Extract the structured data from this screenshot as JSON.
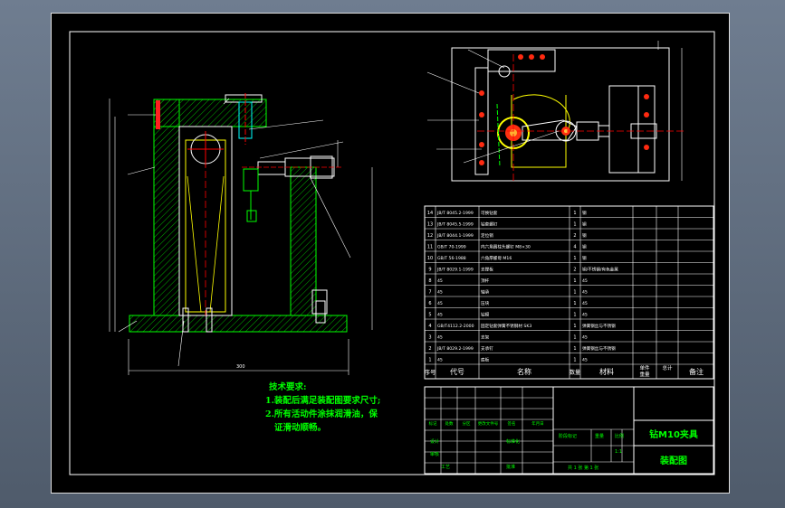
{
  "bom": {
    "header": {
      "no": "序号",
      "code": "代号",
      "name": "名称",
      "qty": "数量",
      "material": "材料",
      "unit_weight_a": "单件",
      "unit_weight_b": "重量",
      "total_weight_a": "总计",
      "total_weight_b": "",
      "remark": "备注"
    },
    "rows": [
      {
        "no": "14",
        "code": "JB/T 8045.2-1999",
        "name": "可换钻套",
        "qty": "1",
        "material": "钢",
        "remark": ""
      },
      {
        "no": "13",
        "code": "JB/T 8045.5-1999",
        "name": "钻套螺钉",
        "qty": "1",
        "material": "钢",
        "remark": ""
      },
      {
        "no": "12",
        "code": "JB/T 8044.1-1999",
        "name": "定位销",
        "qty": "2",
        "material": "钢",
        "remark": ""
      },
      {
        "no": "11",
        "code": "GB/T 70-1999",
        "name": "内六角圆柱头螺钉 M8×30",
        "qty": "4",
        "material": "钢",
        "remark": ""
      },
      {
        "no": "10",
        "code": "GB/T 56-1988",
        "name": "六角厚螺母 M16",
        "qty": "1",
        "material": "钢",
        "remark": ""
      },
      {
        "no": "9",
        "code": "JB/T 8029.1-1999",
        "name": "支撑板",
        "qty": "2",
        "material": "铜/不锈钢/有色金属",
        "remark": ""
      },
      {
        "no": "8",
        "code": "45",
        "name": "顶杆",
        "qty": "1",
        "material": "45",
        "remark": ""
      },
      {
        "no": "7",
        "code": "45",
        "name": "轴承",
        "qty": "1",
        "material": "45",
        "remark": ""
      },
      {
        "no": "6",
        "code": "45",
        "name": "压块",
        "qty": "1",
        "material": "45",
        "remark": ""
      },
      {
        "no": "5",
        "code": "45",
        "name": "钻模",
        "qty": "1",
        "material": "45",
        "remark": ""
      },
      {
        "no": "4",
        "code": "GB/T4112.2-2000",
        "name": "固定钻套弹簧不锈钢材 SK3",
        "qty": "1",
        "material": "弹簧钢丝与不锈钢",
        "remark": ""
      },
      {
        "no": "3",
        "code": "45",
        "name": "支架",
        "qty": "1",
        "material": "45",
        "remark": ""
      },
      {
        "no": "2",
        "code": "JB/T 8029.2-1999",
        "name": "支承钉",
        "qty": "1",
        "material": "弹簧钢丝与不锈钢",
        "remark": ""
      },
      {
        "no": "1",
        "code": "45",
        "name": "底板",
        "qty": "1",
        "material": "45",
        "remark": ""
      }
    ]
  },
  "requirements": {
    "title": "技术要求:",
    "items": [
      "1.装配后满足装配图要求尺寸;",
      "2.所有活动件涂抹润滑油，保",
      "证滑动顺畅。"
    ]
  },
  "title_block": {
    "drawing_name": "钻M10夹具",
    "drawing_type": "装配图",
    "sign_labels": [
      "标记",
      "处数",
      "分区",
      "更改文件号",
      "签名",
      "年月日"
    ],
    "role_labels": [
      "设计",
      "审核",
      "工艺"
    ],
    "standardize": "标准化",
    "approve": "批准",
    "stage_label": "阶段标记",
    "weight_label": "重量",
    "scale_label": "比例",
    "scale": "1:1",
    "sheet_info": "共 1 张   第 1 张"
  },
  "colors": {
    "line": "#ffffff",
    "outline": "#00ff00",
    "hatch": "#00cc00",
    "dim": "#ffffff",
    "accent": "#ff0000",
    "steel": "#00ffff",
    "hole": "#ff3300",
    "yellow": "#ffff00"
  }
}
